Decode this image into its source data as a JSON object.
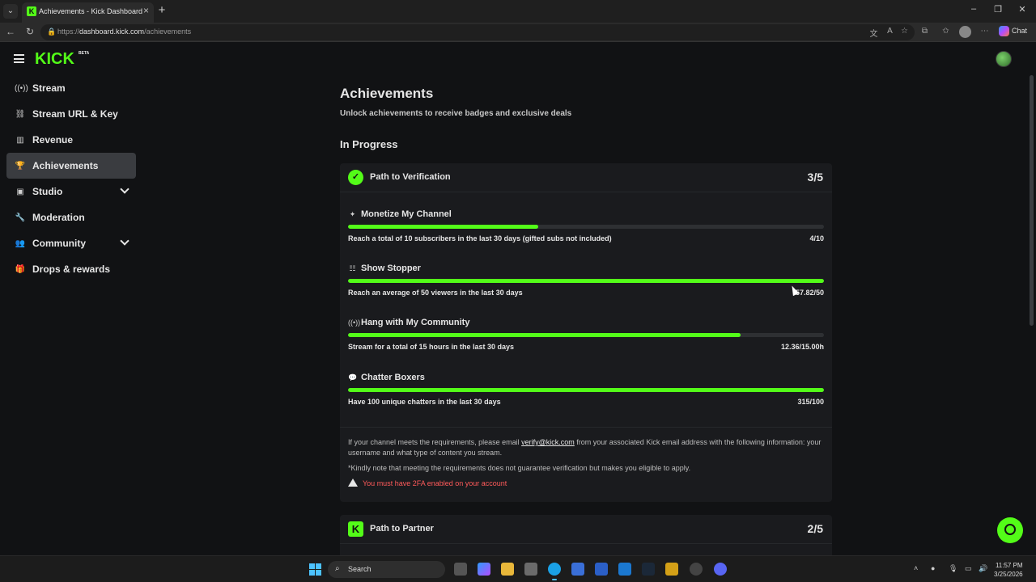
{
  "browser": {
    "tab_title": "Achievements - Kick Dashboard",
    "tab_favicon": "K",
    "url_prefix": "https://",
    "url_domain": "dashboard.kick.com",
    "url_path": "/achievements",
    "chat_label": "Chat"
  },
  "app": {
    "logo": "KICK",
    "logo_badge": "BETA"
  },
  "sidebar": {
    "items": [
      {
        "label": "Stream",
        "icon": "broadcast-icon",
        "glyph": "((•))"
      },
      {
        "label": "Stream URL & Key",
        "icon": "link-icon",
        "glyph": "⛓"
      },
      {
        "label": "Revenue",
        "icon": "chart-icon",
        "glyph": "▥"
      },
      {
        "label": "Achievements",
        "icon": "trophy-icon",
        "glyph": "🏆"
      },
      {
        "label": "Studio",
        "icon": "studio-icon",
        "glyph": "▣"
      },
      {
        "label": "Moderation",
        "icon": "wrench-icon",
        "glyph": "🔧"
      },
      {
        "label": "Community",
        "icon": "people-icon",
        "glyph": "👥"
      },
      {
        "label": "Drops & rewards",
        "icon": "gift-icon",
        "glyph": "🎁"
      }
    ]
  },
  "main": {
    "title": "Achievements",
    "subtitle": "Unlock achievements to receive badges and exclusive deals",
    "section": "In Progress"
  },
  "verification": {
    "title": "Path to Verification",
    "count": "3/5",
    "achievements": [
      {
        "name": "Monetize My Channel",
        "icon": "sparkle-icon",
        "glyph": "✦",
        "desc": "Reach a total of 10 subscribers in the last 30 days (gifted subs not included)",
        "value": "4/10",
        "progress": 0.4
      },
      {
        "name": "Show Stopper",
        "icon": "viewers-icon",
        "glyph": "☷",
        "desc": "Reach an average of 50 viewers in the last 30 days",
        "value": "57.82/50",
        "progress": 1.0
      },
      {
        "name": "Hang with My Community",
        "icon": "broadcast-icon",
        "glyph": "((•))",
        "desc": "Stream for a total of 15 hours in the last 30 days",
        "value": "12.36/15.00h",
        "progress": 0.824
      },
      {
        "name": "Chatter Boxers",
        "icon": "chat-icon",
        "glyph": "💬",
        "desc": "Have 100 unique chatters in the last 30 days",
        "value": "315/100",
        "progress": 1.0
      }
    ],
    "note_part1": "If your channel meets the requirements, please email ",
    "note_email": "verify@kick.com",
    "note_part2": " from your associated Kick email address with the following information: your username and what type of content you stream.",
    "disclaimer": "*Kindly note that meeting the requirements does not guarantee verification but makes you eligible to apply.",
    "warning": "You must have 2FA enabled on your account"
  },
  "partner": {
    "title": "Path to Partner",
    "count": "2/5",
    "badge": "K"
  },
  "taskbar": {
    "search_label": "Search",
    "time": "11:57 PM",
    "date": "3/25/2026"
  },
  "colors": {
    "accent": "#53fc18",
    "warning": "#ff5a5a",
    "background": "#111214",
    "card": "#1a1b1e"
  }
}
